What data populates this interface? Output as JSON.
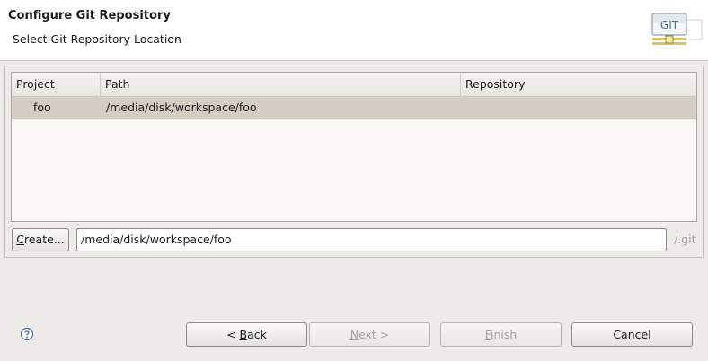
{
  "header": {
    "title": "Configure Git Repository",
    "subtitle": "Select Git Repository Location",
    "logo_text": "GIT",
    "logo_icon": "git-logo-icon"
  },
  "table": {
    "columns": [
      "Project",
      "Path",
      "Repository"
    ],
    "rows": [
      {
        "project": "foo",
        "path": "/media/disk/workspace/foo",
        "repository": ""
      }
    ],
    "selected_row_color": "#d5cdc4"
  },
  "create_button": {
    "label_mnemonic": "C",
    "label_rest": "reate..."
  },
  "path_field": {
    "value": "/media/disk/workspace/foo"
  },
  "suffix": "/.git",
  "buttons": {
    "back": {
      "prefix": "< ",
      "mnemonic": "B",
      "rest": "ack"
    },
    "next": {
      "mnemonic": "N",
      "rest": "ext >"
    },
    "finish": {
      "mnemonic": "F",
      "rest": "inish"
    },
    "cancel": "Cancel"
  },
  "help_icon": "help-icon"
}
